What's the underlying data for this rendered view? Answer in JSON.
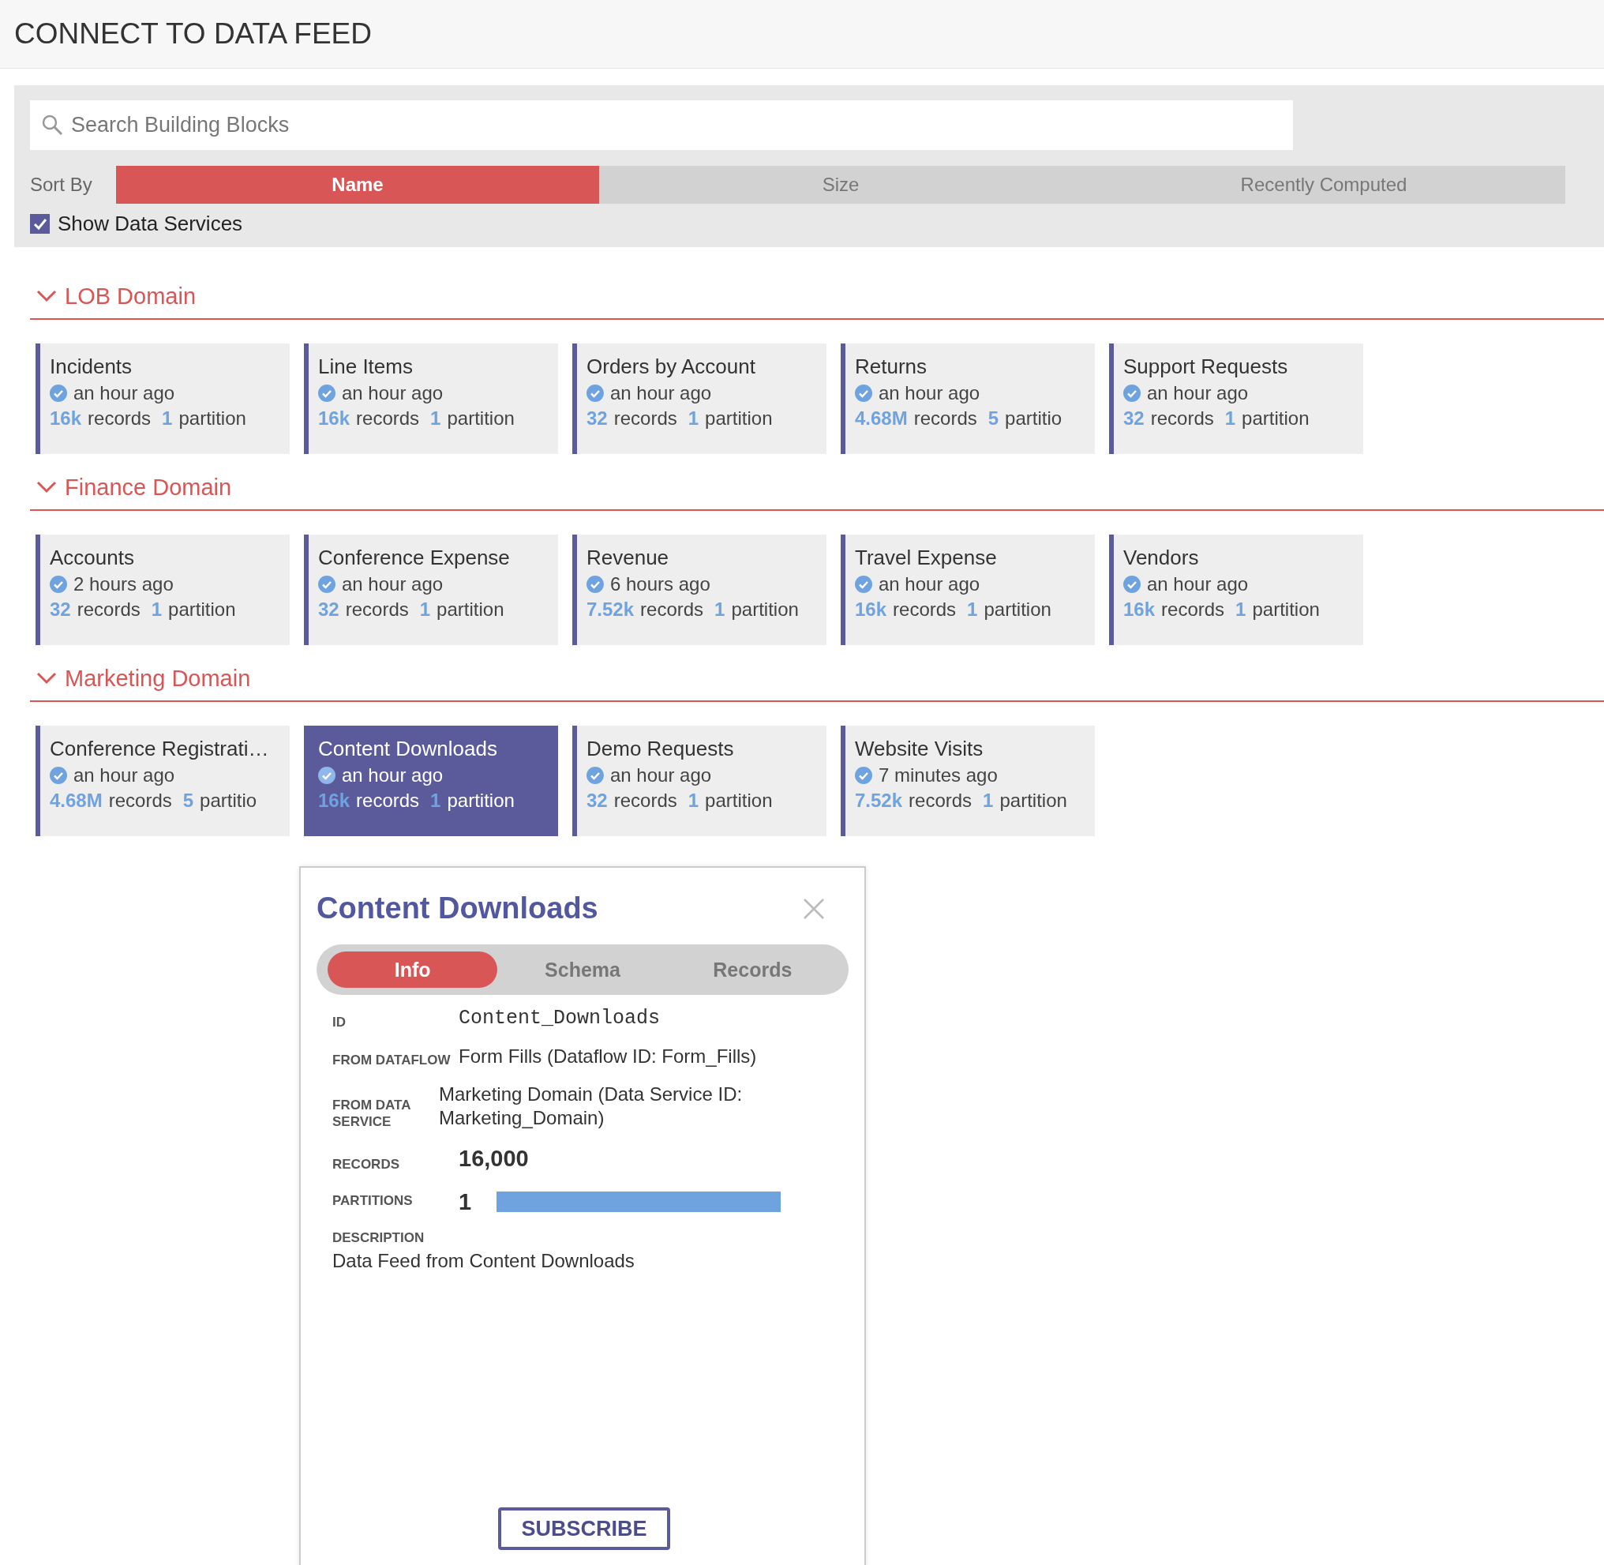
{
  "header": {
    "title": "CONNECT TO DATA FEED"
  },
  "filters": {
    "search": {
      "placeholder": "Search Building Blocks"
    },
    "sort_label": "Sort By",
    "sort_options": [
      {
        "label": "Name",
        "selected": true
      },
      {
        "label": "Size",
        "selected": false
      },
      {
        "label": "Recently Computed",
        "selected": false
      }
    ],
    "show_services": {
      "label": "Show Data Services",
      "checked": true
    }
  },
  "sections": [
    {
      "title": "LOB Domain",
      "expanded": true,
      "cards": [
        {
          "name": "Incidents",
          "time": "an hour ago",
          "records": "16k",
          "records_label": "records",
          "partitions": "1",
          "partitions_label": "partition",
          "selected": false
        },
        {
          "name": "Line Items",
          "time": "an hour ago",
          "records": "16k",
          "records_label": "records",
          "partitions": "1",
          "partitions_label": "partition",
          "selected": false
        },
        {
          "name": "Orders by Account",
          "time": "an hour ago",
          "records": "32",
          "records_label": "records",
          "partitions": "1",
          "partitions_label": "partition",
          "selected": false
        },
        {
          "name": "Returns",
          "time": "an hour ago",
          "records": "4.68M",
          "records_label": "records",
          "partitions": "5",
          "partitions_label": "partitio",
          "selected": false
        },
        {
          "name": "Support Requests",
          "time": "an hour ago",
          "records": "32",
          "records_label": "records",
          "partitions": "1",
          "partitions_label": "partition",
          "selected": false
        }
      ]
    },
    {
      "title": "Finance Domain",
      "expanded": true,
      "cards": [
        {
          "name": "Accounts",
          "time": "2 hours ago",
          "records": "32",
          "records_label": "records",
          "partitions": "1",
          "partitions_label": "partition",
          "selected": false
        },
        {
          "name": "Conference Expense",
          "time": "an hour ago",
          "records": "32",
          "records_label": "records",
          "partitions": "1",
          "partitions_label": "partition",
          "selected": false
        },
        {
          "name": "Revenue",
          "time": "6 hours ago",
          "records": "7.52k",
          "records_label": "records",
          "partitions": "1",
          "partitions_label": "partition",
          "selected": false
        },
        {
          "name": "Travel Expense",
          "time": "an hour ago",
          "records": "16k",
          "records_label": "records",
          "partitions": "1",
          "partitions_label": "partition",
          "selected": false
        },
        {
          "name": "Vendors",
          "time": "an hour ago",
          "records": "16k",
          "records_label": "records",
          "partitions": "1",
          "partitions_label": "partition",
          "selected": false
        }
      ]
    },
    {
      "title": "Marketing Domain",
      "expanded": true,
      "cards": [
        {
          "name": "Conference Registrati…",
          "time": "an hour ago",
          "records": "4.68M",
          "records_label": "records",
          "partitions": "5",
          "partitions_label": "partitio",
          "selected": false
        },
        {
          "name": "Content Downloads",
          "time": "an hour ago",
          "records": "16k",
          "records_label": "records",
          "partitions": "1",
          "partitions_label": "partition",
          "selected": true
        },
        {
          "name": "Demo Requests",
          "time": "an hour ago",
          "records": "32",
          "records_label": "records",
          "partitions": "1",
          "partitions_label": "partition",
          "selected": false
        },
        {
          "name": "Website Visits",
          "time": "7 minutes ago",
          "records": "7.52k",
          "records_label": "records",
          "partitions": "1",
          "partitions_label": "partition",
          "selected": false
        }
      ]
    }
  ],
  "detail": {
    "title": "Content Downloads",
    "tabs": [
      {
        "label": "Info",
        "selected": true
      },
      {
        "label": "Schema",
        "selected": false
      },
      {
        "label": "Records",
        "selected": false
      }
    ],
    "fields": [
      {
        "kind": "mono",
        "label": "ID",
        "value": "Content_Downloads"
      },
      {
        "kind": "text",
        "label": "FROM DATAFLOW",
        "value": "Form Fills (Dataflow ID: Form_Fills)"
      },
      {
        "kind": "wide",
        "label": "FROM DATA SERVICE",
        "value": "Marketing Domain (Data Service ID: Marketing_Domain)"
      },
      {
        "kind": "big",
        "label": "RECORDS",
        "value": "16,000"
      },
      {
        "kind": "bar",
        "label": "PARTITIONS",
        "value": "1"
      },
      {
        "kind": "block",
        "label": "DESCRIPTION",
        "value": "Data Feed from Content Downloads"
      }
    ],
    "button": "SUBSCRIBE"
  }
}
